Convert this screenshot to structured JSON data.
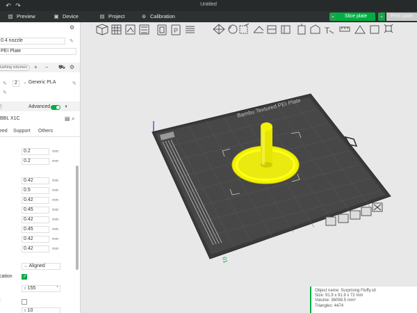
{
  "app": {
    "window_title": "Untitled",
    "colors": {
      "accent": "#00ae42",
      "titlebar": "#262a2b",
      "menubar": "#2d3132"
    }
  },
  "titlebar": {
    "left_icons": [
      "undo-icon",
      "redo-icon"
    ]
  },
  "menubar": {
    "tabs": [
      {
        "label": "Preview",
        "icon": "preview-icon"
      },
      {
        "label": "Device",
        "icon": "device-icon"
      },
      {
        "label": "Project",
        "icon": "project-icon"
      },
      {
        "label": "Calibration",
        "icon": "calibration-icon"
      }
    ],
    "slice_label": "Slice plate",
    "print_label": "Print plate"
  },
  "printer": {
    "nozzle": "0.4 nozzle",
    "plate": "PEI Plate",
    "flushing_label": "flushing volumes"
  },
  "filament": {
    "slot": "2",
    "name": "Generic PLA"
  },
  "process": {
    "section_label": "ts",
    "advanced_label": "Advanced",
    "preset": "BBL X1C",
    "subtabs": [
      "eed",
      "Support",
      "Others"
    ]
  },
  "params": {
    "group1": [
      {
        "value": "0.2",
        "unit": "mm"
      },
      {
        "value": "0.2",
        "unit": "mm"
      }
    ],
    "group2": [
      {
        "value": "0.42",
        "unit": "mm"
      },
      {
        "value": "0.5",
        "unit": "mm"
      },
      {
        "value": "0.42",
        "unit": "mm"
      },
      {
        "value": "0.45",
        "unit": "mm"
      },
      {
        "value": "0.42",
        "unit": "mm"
      },
      {
        "value": "0.45",
        "unit": "mm"
      },
      {
        "value": "0.42",
        "unit": "mm"
      },
      {
        "value": "0.42",
        "unit": "mm"
      }
    ],
    "seam_value": "Aligned",
    "cation_label": "cation",
    "angle_value": "155",
    "angle_unit": "°",
    "last_value": "10"
  },
  "plate_info": {
    "plate_name": "Bambu Textured PEI Plate",
    "plate_number": "01"
  },
  "object_info": {
    "name": "Object name: Surprising Fluffy.stl",
    "size": "Size: 91.9 x 91.9 x 72 mm",
    "volume": "Volume: 36098.5 mm³",
    "triangles": "Triangles: 4474"
  }
}
